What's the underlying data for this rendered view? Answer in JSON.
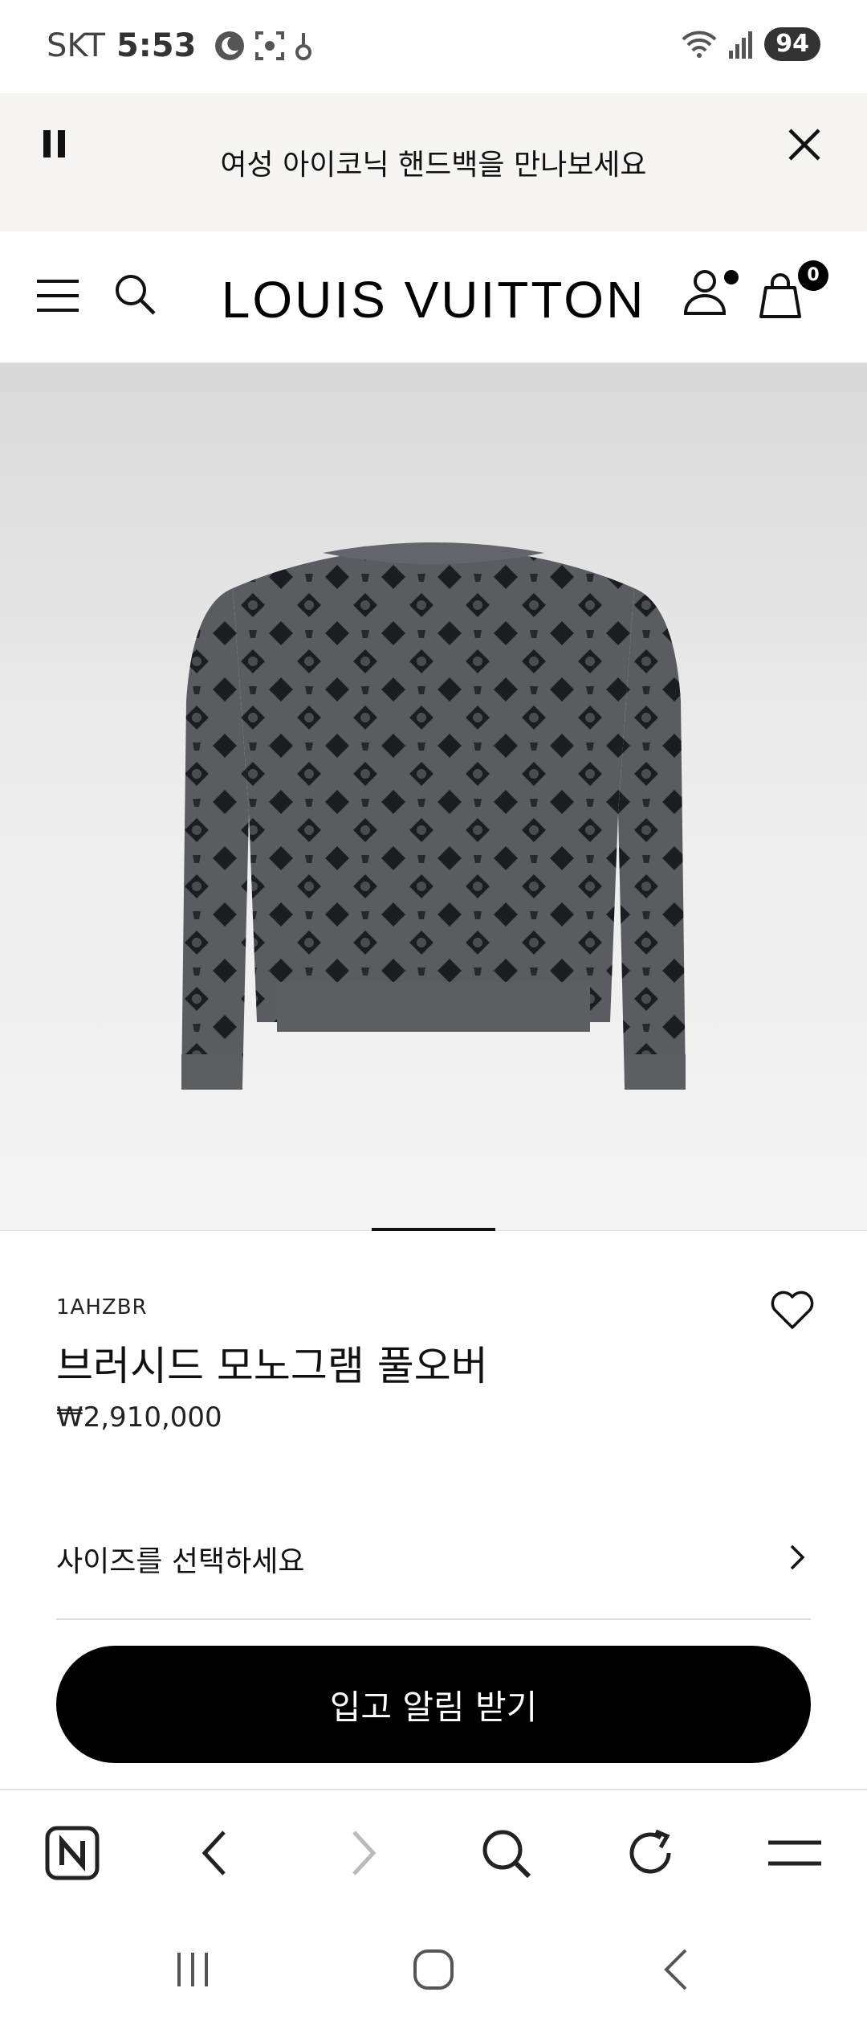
{
  "status_bar": {
    "carrier": "SKT",
    "time": "5:53",
    "battery": "94",
    "left_icons": [
      "moon-icon",
      "screen-capture-icon",
      "hand-icon"
    ],
    "right_icons": [
      "wifi-icon",
      "signal-icon"
    ]
  },
  "promo": {
    "text": "여성 아이코닉 핸드백을 만나보세요",
    "pause_icon": "pause-icon",
    "close_icon": "close-icon"
  },
  "header": {
    "logo": "LOUIS VUITTON",
    "cart_count": "0",
    "icons": [
      "menu-icon",
      "search-icon",
      "account-icon",
      "shopping-bag-icon"
    ]
  },
  "product": {
    "sku": "1AHZBR",
    "name": "브러시드 모노그램 풀오버",
    "price": "₩2,910,000",
    "size_prompt": "사이즈를 선택하세요",
    "notify_button": "입고 알림 받기",
    "image_alt_colors": {
      "body": "#5a5c60",
      "pattern": "#1c1d20",
      "background": "#e8e8e8"
    }
  },
  "browser_toolbar": {
    "items": [
      "naver-home-icon",
      "back-icon",
      "forward-icon",
      "search-icon",
      "refresh-icon",
      "menu-icon"
    ]
  },
  "system_nav": {
    "items": [
      "recent-apps-icon",
      "home-icon",
      "back-icon"
    ]
  },
  "colors": {
    "accent": "#000000",
    "banner_bg": "#f6f5f3",
    "divider": "#dddddd"
  }
}
